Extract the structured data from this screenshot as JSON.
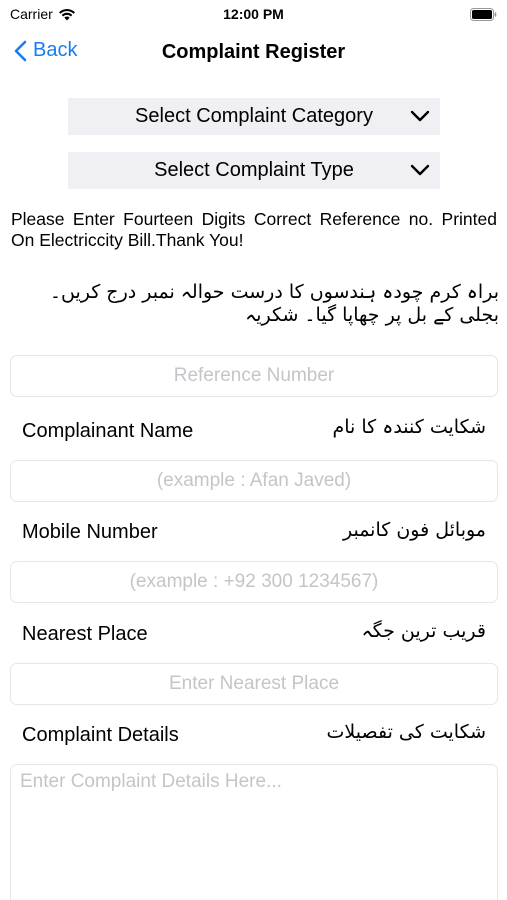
{
  "status_bar": {
    "carrier": "Carrier",
    "time": "12:00 PM",
    "wifi_icon": "wifi-icon",
    "battery_icon": "battery-icon"
  },
  "nav": {
    "back_label": "Back",
    "title": "Complaint Register",
    "accent_color": "#1a7cf3"
  },
  "dropdowns": {
    "category": "Select Complaint Category",
    "type": "Select Complaint Type"
  },
  "notice": {
    "english": "Please Enter Fourteen Digits Correct Reference no. Printed On Electriccity Bill.Thank You!",
    "urdu": "براہ کرم چودہ ہندسوں کا درست حوالہ نمبر درج کریں۔ بجلی کے بل پر چھاپا گیا۔ شکریہ"
  },
  "form": {
    "reference": {
      "placeholder": "Reference Number",
      "value": ""
    },
    "name": {
      "label_en": "Complainant Name",
      "label_ur": "شکایت کنندہ کا نام",
      "placeholder": "(example : Afan Javed)",
      "value": ""
    },
    "mobile": {
      "label_en": "Mobile Number",
      "label_ur": "موبائل فون کانمبر",
      "placeholder": "(example : +92 300 1234567)",
      "value": ""
    },
    "place": {
      "label_en": "Nearest Place",
      "label_ur": "قریب ترین جگہ",
      "placeholder": "Enter Nearest Place",
      "value": ""
    },
    "details": {
      "label_en": "Complaint Details",
      "label_ur": "شکایت کی تفصیلات",
      "placeholder": "Enter Complaint Details Here...",
      "value": ""
    }
  }
}
